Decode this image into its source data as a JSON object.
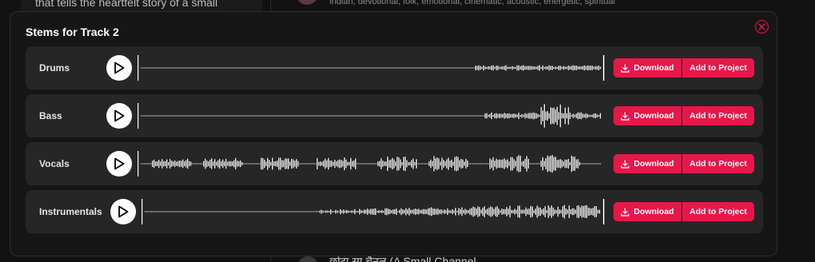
{
  "background": {
    "left_snippet": "that tells the heartfelt story of a small",
    "tags": "indian, devotional, folk, emotional, cinematic, acoustic, energetic, spiritual",
    "bottom_title": "छोटा सा चैनल (A Small Channel"
  },
  "modal": {
    "title": "Stems for Track 2",
    "download_label": "Download",
    "add_label": "Add to Project",
    "stems": [
      {
        "label": "Drums"
      },
      {
        "label": "Bass"
      },
      {
        "label": "Vocals"
      },
      {
        "label": "Instrumentals"
      }
    ]
  },
  "colors": {
    "accent": "#e8174a",
    "panel": "#262626",
    "modal_bg": "#161616"
  },
  "icons": {
    "close": "close-icon",
    "play": "play-icon",
    "download": "download-icon"
  }
}
